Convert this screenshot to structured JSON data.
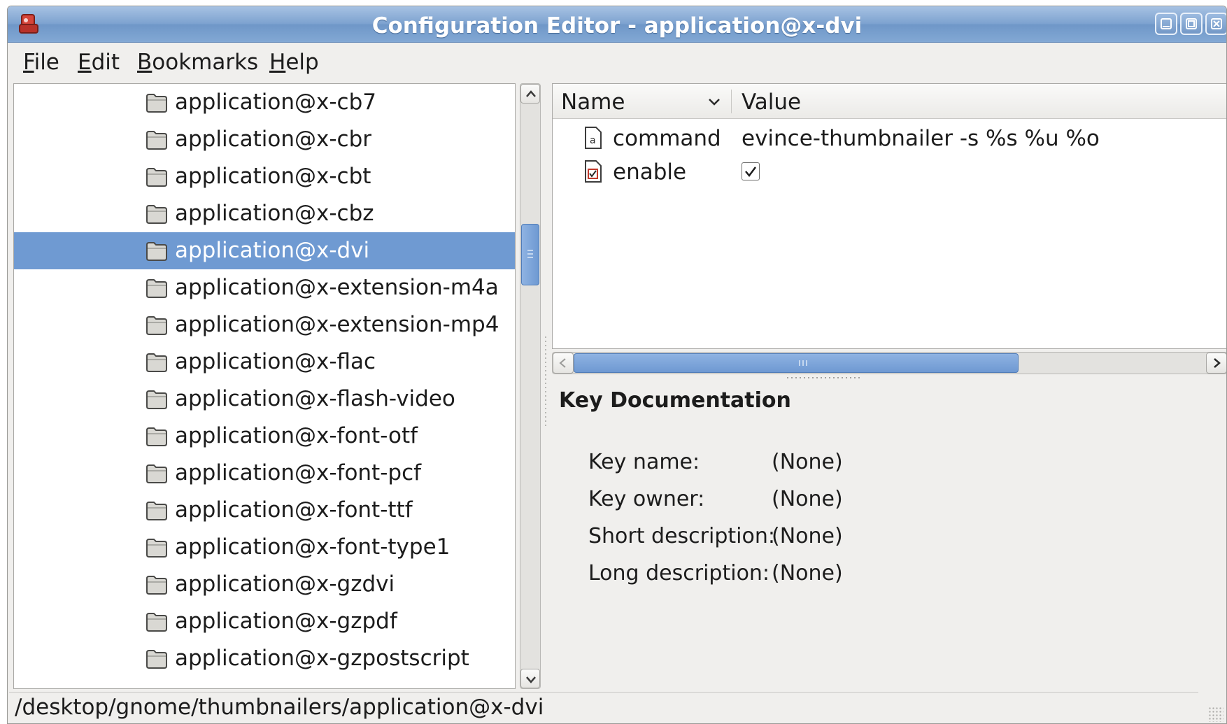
{
  "window": {
    "title": "Configuration Editor - application@x-dvi",
    "controls": [
      "minimize",
      "maximize",
      "close"
    ]
  },
  "menu": {
    "items": [
      {
        "mnemonic": "F",
        "rest": "ile"
      },
      {
        "mnemonic": "E",
        "rest": "dit"
      },
      {
        "mnemonic": "B",
        "rest": "ookmarks"
      },
      {
        "mnemonic": "H",
        "rest": "elp"
      }
    ]
  },
  "tree": {
    "selected": "application@x-dvi",
    "items": [
      "application@x-cb7",
      "application@x-cbr",
      "application@x-cbt",
      "application@x-cbz",
      "application@x-dvi",
      "application@x-extension-m4a",
      "application@x-extension-mp4",
      "application@x-flac",
      "application@x-flash-video",
      "application@x-font-otf",
      "application@x-font-pcf",
      "application@x-font-ttf",
      "application@x-font-type1",
      "application@x-gzdvi",
      "application@x-gzpdf",
      "application@x-gzpostscript"
    ]
  },
  "keys": {
    "columns": {
      "name": "Name",
      "value": "Value"
    },
    "rows": [
      {
        "name": "command",
        "type": "string",
        "value": "evince-thumbnailer -s %s %u %o"
      },
      {
        "name": "enable",
        "type": "bool",
        "checked": true
      }
    ]
  },
  "documentation": {
    "title": "Key Documentation",
    "fields": [
      {
        "label": "Key name:",
        "value": "(None)"
      },
      {
        "label": "Key owner:",
        "value": "(None)"
      },
      {
        "label": "Short description:",
        "value": "(None)"
      },
      {
        "label": "Long description:",
        "value": "(None)"
      }
    ]
  },
  "status": {
    "path": "/desktop/gnome/thumbnailers/application@x-dvi"
  },
  "colors": {
    "selection": "#6f9ad2",
    "titlebar": "#7ea3d0"
  }
}
